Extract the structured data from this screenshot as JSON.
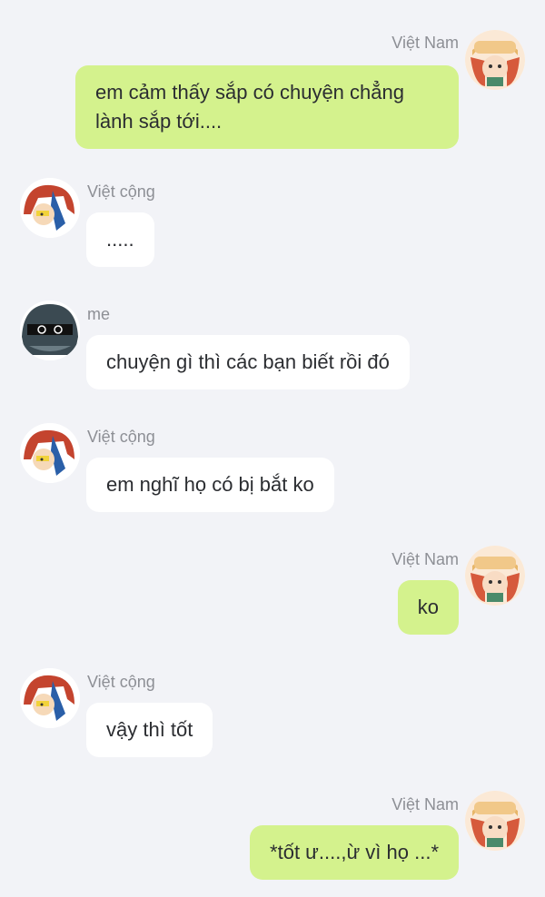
{
  "messages": [
    {
      "sender": "Việt Nam",
      "side": "right",
      "text": "em cảm thấy sắp có chuyện chẳng lành sắp tới....",
      "avatar": "viet-nam-avatar-icon"
    },
    {
      "sender": "Việt cộng",
      "side": "left",
      "text": ".....",
      "avatar": "viet-cong-avatar-icon"
    },
    {
      "sender": "me",
      "side": "left",
      "text": "chuyện gì thì các bạn biết rồi đó",
      "avatar": "me-avatar-icon"
    },
    {
      "sender": "Việt cộng",
      "side": "left",
      "text": "em nghĩ họ có bị bắt ko",
      "avatar": "viet-cong-avatar-icon"
    },
    {
      "sender": "Việt Nam",
      "side": "right",
      "text": "ko",
      "avatar": "viet-nam-avatar-icon"
    },
    {
      "sender": "Việt cộng",
      "side": "left",
      "text": "vậy thì tốt",
      "avatar": "viet-cong-avatar-icon"
    },
    {
      "sender": "Việt Nam",
      "side": "right",
      "text": "*tốt ư....,ừ vì họ ...*",
      "avatar": "viet-nam-avatar-icon"
    }
  ],
  "colors": {
    "background": "#f2f3f7",
    "outgoing_bubble": "#d4f28d",
    "incoming_bubble": "#ffffff",
    "sender_name": "#8d8f95",
    "text": "#2b2d31"
  }
}
